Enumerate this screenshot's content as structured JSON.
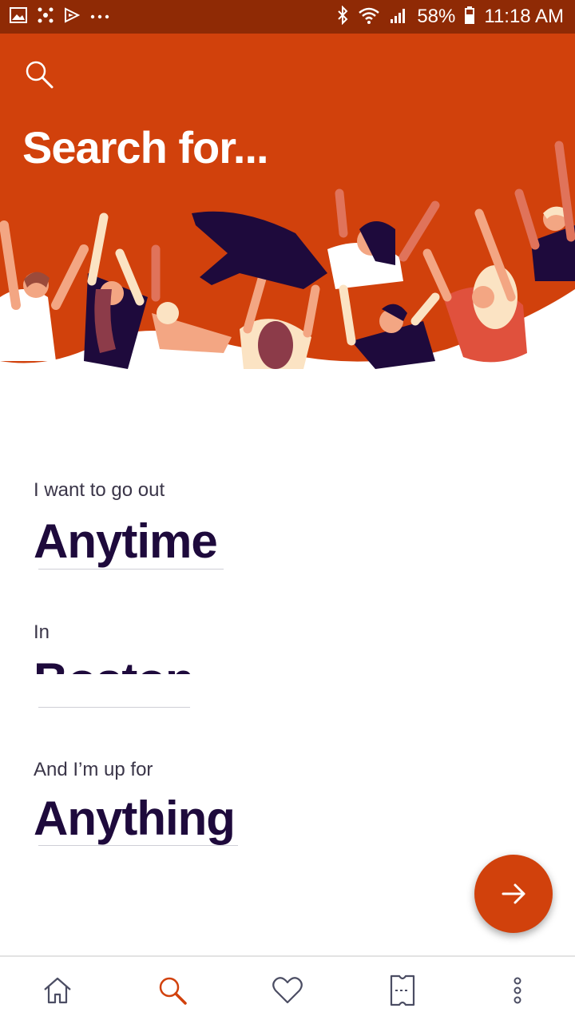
{
  "status_bar": {
    "battery": "58%",
    "time": "11:18 AM",
    "icons": [
      "gallery-icon",
      "app-icon",
      "play-icon",
      "more-dots",
      "bluetooth-icon",
      "wifi-icon",
      "signal-icon",
      "battery-icon"
    ]
  },
  "header": {
    "title": "Search for...",
    "search_icon": "search-icon"
  },
  "form": {
    "when_label": "I want to go out",
    "when_value": "Anytime",
    "where_label": "In",
    "where_value": "Boston",
    "what_label": "And I’m up for",
    "what_value": "Anything"
  },
  "fab": {
    "icon": "arrow-right-icon"
  },
  "bottom_nav": {
    "items": [
      "home-icon",
      "search-icon",
      "heart-icon",
      "ticket-icon",
      "more-icon"
    ],
    "active": "search"
  },
  "colors": {
    "accent": "#d1410c",
    "status_bar": "#8f2a05",
    "text_dark": "#1e0a3c"
  }
}
